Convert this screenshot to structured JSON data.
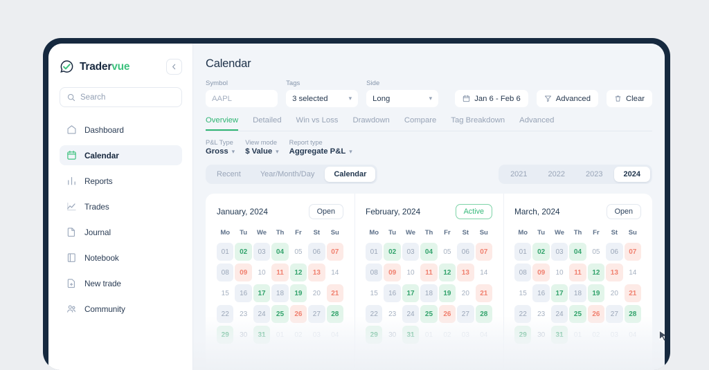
{
  "sidebar": {
    "logo": {
      "name_dark": "Trader",
      "name_accent": "vue",
      "mark_icon": "tradervue-logo-icon"
    },
    "collapse_icon": "chevron-left-icon",
    "search": {
      "placeholder": "Search",
      "icon": "search-icon"
    },
    "items": [
      {
        "label": "Dashboard",
        "icon": "home-icon",
        "active": false
      },
      {
        "label": "Calendar",
        "icon": "calendar-icon",
        "active": true
      },
      {
        "label": "Reports",
        "icon": "bar-chart-icon",
        "active": false
      },
      {
        "label": "Trades",
        "icon": "line-chart-icon",
        "active": false
      },
      {
        "label": "Journal",
        "icon": "document-icon",
        "active": false
      },
      {
        "label": "Notebook",
        "icon": "notebook-icon",
        "active": false
      },
      {
        "label": "New trade",
        "icon": "file-plus-icon",
        "active": false
      },
      {
        "label": "Community",
        "icon": "people-icon",
        "active": false
      }
    ]
  },
  "header": {
    "title": "Calendar"
  },
  "filters": {
    "symbol": {
      "label": "Symbol",
      "value": "",
      "placeholder": "AAPL"
    },
    "tags": {
      "label": "Tags",
      "value": "3 selected"
    },
    "side": {
      "label": "Side",
      "value": "Long"
    },
    "date_range": {
      "label": "Jan 6 - Feb 6",
      "icon": "calendar-icon"
    },
    "advanced": {
      "label": "Advanced",
      "icon": "filter-icon"
    },
    "clear": {
      "label": "Clear",
      "icon": "trash-icon"
    }
  },
  "tabs": [
    {
      "label": "Overview",
      "active": true
    },
    {
      "label": "Detailed",
      "active": false
    },
    {
      "label": "Win vs Loss",
      "active": false
    },
    {
      "label": "Drawdown",
      "active": false
    },
    {
      "label": "Compare",
      "active": false
    },
    {
      "label": "Tag Breakdown",
      "active": false
    },
    {
      "label": "Advanced",
      "active": false
    }
  ],
  "sub_controls": [
    {
      "label": "P&L Type",
      "value": "Gross"
    },
    {
      "label": "View mode",
      "value": "$ Value"
    },
    {
      "label": "Report type",
      "value": "Aggregate P&L"
    }
  ],
  "view_modes": [
    {
      "label": "Recent",
      "active": false
    },
    {
      "label": "Year/Month/Day",
      "active": false
    },
    {
      "label": "Calendar",
      "active": true
    }
  ],
  "years": [
    {
      "label": "2021",
      "active": false
    },
    {
      "label": "2022",
      "active": false
    },
    {
      "label": "2023",
      "active": false
    },
    {
      "label": "2024",
      "active": true
    }
  ],
  "calendar": {
    "weekdays": [
      "Mo",
      "Tu",
      "We",
      "Th",
      "Fr",
      "St",
      "Su"
    ],
    "colors": {
      "positive": "#33a36c",
      "negative": "#f0806f",
      "neutral": "#9aa6b8",
      "accent": "#2fb573"
    },
    "months": [
      {
        "name": "January, 2024",
        "action": {
          "label": "Open",
          "active": false
        },
        "days": [
          [
            {
              "d": "01",
              "s": "neutral"
            },
            {
              "d": "02",
              "s": "pos"
            },
            {
              "d": "03",
              "s": "neutral"
            },
            {
              "d": "04",
              "s": "pos"
            },
            {
              "d": "05",
              "s": "blank"
            },
            {
              "d": "06",
              "s": "neutral"
            },
            {
              "d": "07",
              "s": "neg"
            }
          ],
          [
            {
              "d": "08",
              "s": "neutral"
            },
            {
              "d": "09",
              "s": "neg"
            },
            {
              "d": "10",
              "s": "blank"
            },
            {
              "d": "11",
              "s": "neg"
            },
            {
              "d": "12",
              "s": "pos"
            },
            {
              "d": "13",
              "s": "neg"
            },
            {
              "d": "14",
              "s": "blank"
            }
          ],
          [
            {
              "d": "15",
              "s": "blank"
            },
            {
              "d": "16",
              "s": "neutral"
            },
            {
              "d": "17",
              "s": "pos"
            },
            {
              "d": "18",
              "s": "neutral"
            },
            {
              "d": "19",
              "s": "pos"
            },
            {
              "d": "20",
              "s": "blank"
            },
            {
              "d": "21",
              "s": "neg"
            }
          ],
          [
            {
              "d": "22",
              "s": "neutral"
            },
            {
              "d": "23",
              "s": "blank"
            },
            {
              "d": "24",
              "s": "neutral"
            },
            {
              "d": "25",
              "s": "pos"
            },
            {
              "d": "26",
              "s": "neg"
            },
            {
              "d": "27",
              "s": "neutral"
            },
            {
              "d": "28",
              "s": "pos"
            }
          ],
          [
            {
              "d": "29",
              "s": "pos"
            },
            {
              "d": "30",
              "s": "blank"
            },
            {
              "d": "31",
              "s": "pos"
            },
            {
              "d": "01",
              "s": "out"
            },
            {
              "d": "02",
              "s": "out"
            },
            {
              "d": "03",
              "s": "out"
            },
            {
              "d": "04",
              "s": "out"
            }
          ]
        ]
      },
      {
        "name": "February, 2024",
        "action": {
          "label": "Active",
          "active": true
        },
        "days": [
          [
            {
              "d": "01",
              "s": "neutral"
            },
            {
              "d": "02",
              "s": "pos"
            },
            {
              "d": "03",
              "s": "neutral"
            },
            {
              "d": "04",
              "s": "pos"
            },
            {
              "d": "05",
              "s": "blank"
            },
            {
              "d": "06",
              "s": "neutral"
            },
            {
              "d": "07",
              "s": "neg"
            }
          ],
          [
            {
              "d": "08",
              "s": "neutral"
            },
            {
              "d": "09",
              "s": "neg"
            },
            {
              "d": "10",
              "s": "blank"
            },
            {
              "d": "11",
              "s": "neg"
            },
            {
              "d": "12",
              "s": "pos"
            },
            {
              "d": "13",
              "s": "neg"
            },
            {
              "d": "14",
              "s": "blank"
            }
          ],
          [
            {
              "d": "15",
              "s": "blank"
            },
            {
              "d": "16",
              "s": "neutral"
            },
            {
              "d": "17",
              "s": "pos"
            },
            {
              "d": "18",
              "s": "neutral"
            },
            {
              "d": "19",
              "s": "pos"
            },
            {
              "d": "20",
              "s": "blank"
            },
            {
              "d": "21",
              "s": "neg"
            }
          ],
          [
            {
              "d": "22",
              "s": "neutral"
            },
            {
              "d": "23",
              "s": "blank"
            },
            {
              "d": "24",
              "s": "neutral"
            },
            {
              "d": "25",
              "s": "pos"
            },
            {
              "d": "26",
              "s": "neg"
            },
            {
              "d": "27",
              "s": "neutral"
            },
            {
              "d": "28",
              "s": "pos"
            }
          ],
          [
            {
              "d": "29",
              "s": "pos"
            },
            {
              "d": "30",
              "s": "blank"
            },
            {
              "d": "31",
              "s": "pos"
            },
            {
              "d": "01",
              "s": "out"
            },
            {
              "d": "02",
              "s": "out"
            },
            {
              "d": "03",
              "s": "out"
            },
            {
              "d": "04",
              "s": "out"
            }
          ]
        ]
      },
      {
        "name": "March, 2024",
        "action": {
          "label": "Open",
          "active": false
        },
        "days": [
          [
            {
              "d": "01",
              "s": "neutral"
            },
            {
              "d": "02",
              "s": "pos"
            },
            {
              "d": "03",
              "s": "neutral"
            },
            {
              "d": "04",
              "s": "pos"
            },
            {
              "d": "05",
              "s": "blank"
            },
            {
              "d": "06",
              "s": "neutral"
            },
            {
              "d": "07",
              "s": "neg"
            }
          ],
          [
            {
              "d": "08",
              "s": "neutral"
            },
            {
              "d": "09",
              "s": "neg"
            },
            {
              "d": "10",
              "s": "blank"
            },
            {
              "d": "11",
              "s": "neg"
            },
            {
              "d": "12",
              "s": "pos"
            },
            {
              "d": "13",
              "s": "neg"
            },
            {
              "d": "14",
              "s": "blank"
            }
          ],
          [
            {
              "d": "15",
              "s": "blank"
            },
            {
              "d": "16",
              "s": "neutral"
            },
            {
              "d": "17",
              "s": "pos"
            },
            {
              "d": "18",
              "s": "neutral"
            },
            {
              "d": "19",
              "s": "pos"
            },
            {
              "d": "20",
              "s": "blank"
            },
            {
              "d": "21",
              "s": "neg"
            }
          ],
          [
            {
              "d": "22",
              "s": "neutral"
            },
            {
              "d": "23",
              "s": "blank"
            },
            {
              "d": "24",
              "s": "neutral"
            },
            {
              "d": "25",
              "s": "pos"
            },
            {
              "d": "26",
              "s": "neg"
            },
            {
              "d": "27",
              "s": "neutral"
            },
            {
              "d": "28",
              "s": "pos"
            }
          ],
          [
            {
              "d": "29",
              "s": "pos"
            },
            {
              "d": "30",
              "s": "blank"
            },
            {
              "d": "31",
              "s": "pos"
            },
            {
              "d": "01",
              "s": "out"
            },
            {
              "d": "02",
              "s": "out"
            },
            {
              "d": "03",
              "s": "out"
            },
            {
              "d": "04",
              "s": "out"
            }
          ]
        ]
      }
    ]
  }
}
